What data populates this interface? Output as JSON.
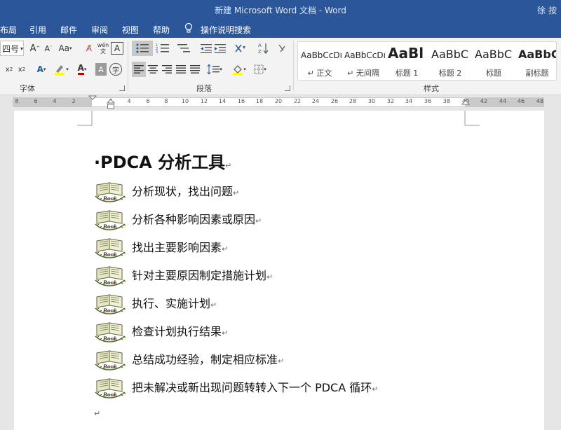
{
  "window": {
    "title": "新建 Microsoft Word 文档 - Word",
    "user": "徐 按"
  },
  "menu": [
    "布局",
    "引用",
    "邮件",
    "审阅",
    "视图",
    "帮助"
  ],
  "tell_me": "操作说明搜索",
  "ribbon": {
    "font_size": "四号",
    "aa_label": "Aa",
    "wen_label": "wén",
    "groups": {
      "font": "字体",
      "paragraph": "段落",
      "styles": "样式"
    },
    "styles": [
      {
        "sample": "AaBbCcDı",
        "name": "↵ 正文"
      },
      {
        "sample": "AaBbCcDı",
        "name": "↵ 无间隔"
      },
      {
        "sample": "AaBl",
        "name": "标题 1"
      },
      {
        "sample": "AaBbC",
        "name": "标题 2"
      },
      {
        "sample": "AaBbC",
        "name": "标题"
      },
      {
        "sample": "AaBbC",
        "name": "副标题"
      }
    ]
  },
  "ruler": {
    "ticks": [
      "8",
      "6",
      "4",
      "2",
      "2",
      "4",
      "6",
      "8",
      "10",
      "12",
      "14",
      "16",
      "18",
      "20",
      "22",
      "24",
      "26",
      "28",
      "30",
      "32",
      "34",
      "36",
      "38",
      "40",
      "42",
      "44",
      "46",
      "48"
    ]
  },
  "document": {
    "title": "·PDCA 分析工具",
    "para_mark": "↵",
    "bullet_label": "Book",
    "items": [
      "分析现状，找出问题",
      "分析各种影响因素或原因",
      "找出主要影响因素",
      "针对主要原因制定措施计划",
      "执行、实施计划",
      "检查计划执行结果",
      "总结成功经验，制定相应标准",
      "把未解决或新出现问题转转入下一个 PDCA 循环"
    ]
  },
  "colors": {
    "titlebar": "#2b579a",
    "ribbon": "#f3f3f3",
    "canvas": "#e6e6e6",
    "accent_red": "#c00000",
    "accent_yellow": "#ffff00"
  }
}
